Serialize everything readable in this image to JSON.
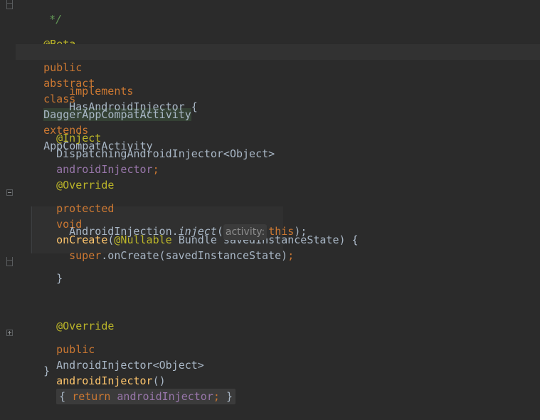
{
  "code": {
    "comment_end": "*/",
    "beta_annotation": "@Beta",
    "line_class": {
      "public": "public",
      "abstract": "abstract",
      "class": "class",
      "class_name": "DaggerAppCompatActivity",
      "extends": "extends",
      "super_class": "AppCompatActivity"
    },
    "line_implements": {
      "implements": "implements",
      "interface": "HasAndroidInjector",
      "brace": " {"
    },
    "line_field": {
      "annotation": "@Inject",
      "type": "DispatchingAndroidInjector<Object>",
      "name": "androidInjector",
      "semicolon": ";"
    },
    "override1": "@Override",
    "line_oncreate": {
      "protected": "protected",
      "void": "void",
      "method": "onCreate",
      "open_paren": "(",
      "annotation": "@Nullable",
      "param": " Bundle savedInstanceState) {"
    },
    "line_inject": {
      "receiver": "AndroidInjection.",
      "method": "inject",
      "open_paren": "(",
      "hint": "activity:",
      "this": "this",
      "close": ");"
    },
    "line_super": {
      "super": "super",
      "call": ".onCreate(savedInstanceState)",
      "semicolon": ";"
    },
    "close_method": "}",
    "override2": "@Override",
    "line_injector": {
      "public": "public",
      "type": "AndroidInjector<Object>",
      "method": "androidInjector",
      "parens": "()",
      "open_brace": "{",
      "return": "return",
      "field": "androidInjector",
      "semicolon": ";",
      "close_brace": "}"
    },
    "close_class": "}"
  },
  "colors": {
    "background": "#2b2b2b",
    "keyword": "#cc7832",
    "annotation": "#bbb529",
    "field": "#9876aa",
    "method_decl": "#ffc66d",
    "text": "#a9b7c6",
    "comment": "#629755"
  }
}
